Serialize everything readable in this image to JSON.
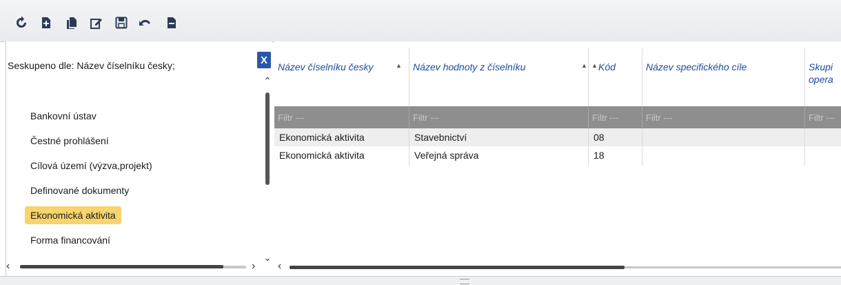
{
  "toolbar": {
    "icons": [
      "refresh-icon",
      "add-icon",
      "copy-icon",
      "edit-icon",
      "save-icon",
      "undo-icon",
      "delete-icon"
    ]
  },
  "grouping": {
    "label": "Seskupeno dle: Název číselníku česky;",
    "remove_label": "X",
    "items": [
      "Bankovní ústav",
      "Čestné prohlášení",
      "Cílová území (výzva,projekt)",
      "Definované dokumenty",
      "Ekonomická aktivita",
      "Forma financování"
    ],
    "selected_index": 4
  },
  "grid": {
    "columns": [
      {
        "label": "Název číselníku česky",
        "sort": "asc"
      },
      {
        "label": "Název hodnoty z číselníku",
        "sort": "asc"
      },
      {
        "label": "Kód",
        "sort": "asc"
      },
      {
        "label": "Název specifického cíle",
        "sort": ""
      },
      {
        "label": "Skupi\nopera",
        "sort": ""
      }
    ],
    "filter_placeholder": "Filtr ---",
    "rows": [
      [
        "Ekonomická aktivita",
        "Stavebnictví",
        "08",
        "",
        ""
      ],
      [
        "Ekonomická aktivita",
        "Veřejná správa",
        "18",
        "",
        ""
      ]
    ]
  },
  "colors": {
    "accent": "#2a57a8",
    "selected_item": "#f7d46e",
    "header_text": "#1e4a9c",
    "filter_bg": "#8e8e8e"
  }
}
